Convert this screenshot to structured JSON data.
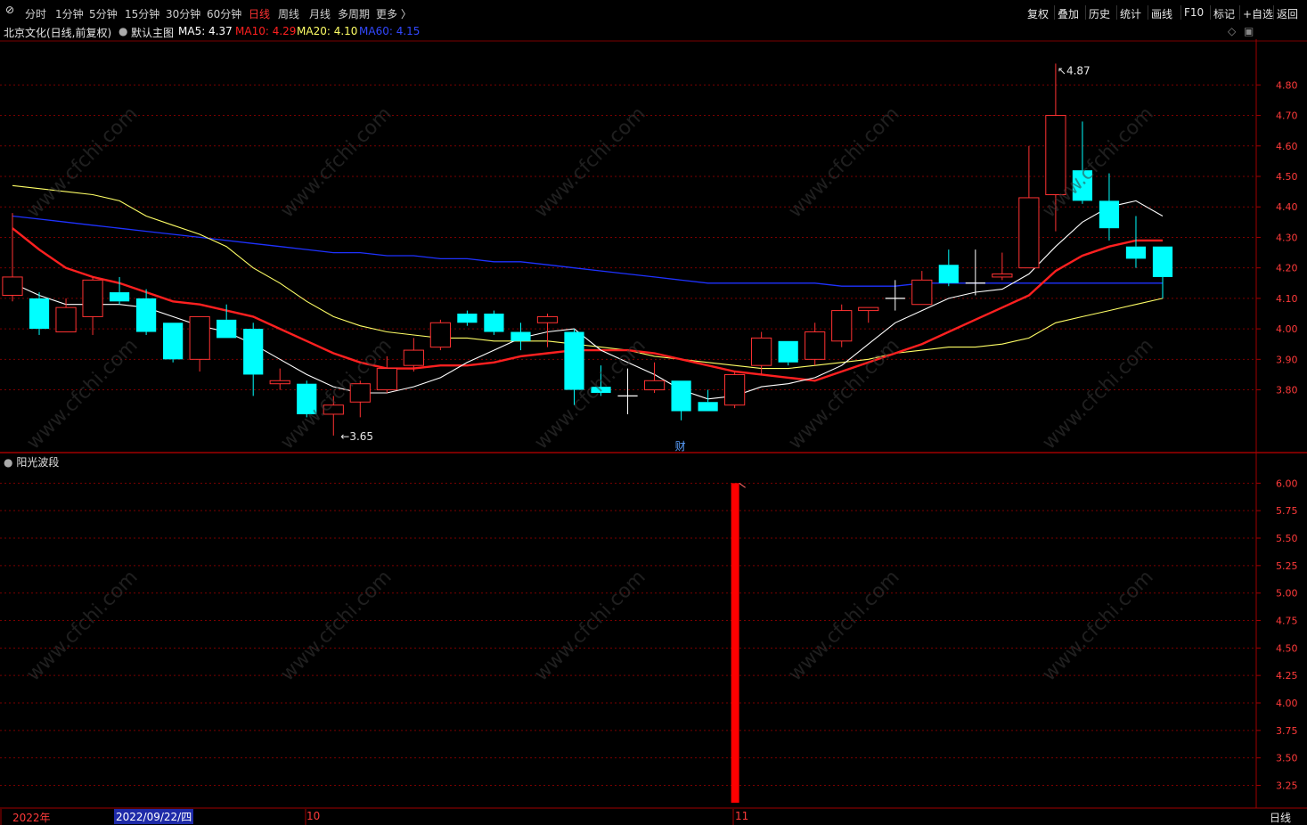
{
  "toolbar": {
    "periods": [
      {
        "label": "分时",
        "active": false
      },
      {
        "label": "1分钟",
        "active": false
      },
      {
        "label": "5分钟",
        "active": false
      },
      {
        "label": "15分钟",
        "active": false
      },
      {
        "label": "30分钟",
        "active": false
      },
      {
        "label": "60分钟",
        "active": false
      },
      {
        "label": "日线",
        "active": true
      },
      {
        "label": "周线",
        "active": false
      },
      {
        "label": "月线",
        "active": false
      },
      {
        "label": "多周期",
        "active": false
      },
      {
        "label": "更多 〉",
        "active": false
      }
    ],
    "tools": [
      "复权",
      "叠加",
      "历史",
      "统计",
      "画线",
      "F10",
      "标记",
      "+自选",
      "返回"
    ]
  },
  "legend": {
    "stock": "北京文化(日线,前复权)",
    "template": "默认主图",
    "ma5": "MA5: 4.37",
    "ma10": "MA10: 4.29",
    "ma20": "MA20: 4.10",
    "ma60": "MA60: 4.15"
  },
  "colors": {
    "up": "#ff3232",
    "down": "#00ffff",
    "ma5": "#ffffff",
    "ma10": "#ff2020",
    "ma20": "#ffff66",
    "ma60": "#1e32ff",
    "grid": "#7a0000",
    "axis_text": "#ff3a3a"
  },
  "main_axis": {
    "ticks": [
      "4.80",
      "4.70",
      "4.60",
      "4.50",
      "4.40",
      "4.30",
      "4.20",
      "4.10",
      "4.00",
      "3.90",
      "3.80"
    ]
  },
  "sub_axis": {
    "ticks": [
      "6.00",
      "5.75",
      "5.50",
      "5.25",
      "5.00",
      "4.75",
      "4.50",
      "4.25",
      "4.00",
      "3.75",
      "3.50",
      "3.25"
    ]
  },
  "annotations": {
    "high": "4.87",
    "low": "3.65",
    "cai": "财"
  },
  "indicator": {
    "name": "阳光波段",
    "bar_value": 6.0
  },
  "status": {
    "year": "2022年",
    "date": "2022/09/22/四",
    "oct": "10",
    "nov": "11",
    "period": "日线"
  },
  "watermark": "www.cfchi.com",
  "chart_data": {
    "type": "candlestick",
    "title": "北京文化(日线,前复权)",
    "ylim": [
      3.6,
      4.95
    ],
    "candles": [
      {
        "o": 4.11,
        "c": 4.17,
        "h": 4.38,
        "l": 4.09
      },
      {
        "o": 4.1,
        "c": 4.0,
        "h": 4.12,
        "l": 3.98
      },
      {
        "o": 3.99,
        "c": 4.07,
        "h": 4.1,
        "l": 3.99
      },
      {
        "o": 4.04,
        "c": 4.16,
        "h": 4.17,
        "l": 3.98
      },
      {
        "o": 4.12,
        "c": 4.09,
        "h": 4.17,
        "l": 4.08
      },
      {
        "o": 4.1,
        "c": 3.99,
        "h": 4.13,
        "l": 3.98
      },
      {
        "o": 4.02,
        "c": 3.9,
        "h": 4.02,
        "l": 3.89
      },
      {
        "o": 3.9,
        "c": 4.04,
        "h": 4.04,
        "l": 3.86
      },
      {
        "o": 4.03,
        "c": 3.97,
        "h": 4.08,
        "l": 3.97
      },
      {
        "o": 4.0,
        "c": 3.85,
        "h": 4.02,
        "l": 3.78
      },
      {
        "o": 3.82,
        "c": 3.83,
        "h": 3.87,
        "l": 3.8
      },
      {
        "o": 3.82,
        "c": 3.72,
        "h": 3.83,
        "l": 3.71
      },
      {
        "o": 3.72,
        "c": 3.75,
        "h": 3.78,
        "l": 3.65
      },
      {
        "o": 3.76,
        "c": 3.82,
        "h": 3.83,
        "l": 3.71
      },
      {
        "o": 3.8,
        "c": 3.87,
        "h": 3.91,
        "l": 3.79
      },
      {
        "o": 3.88,
        "c": 3.93,
        "h": 3.97,
        "l": 3.86
      },
      {
        "o": 3.94,
        "c": 4.02,
        "h": 4.03,
        "l": 3.93
      },
      {
        "o": 4.05,
        "c": 4.02,
        "h": 4.06,
        "l": 4.01
      },
      {
        "o": 4.05,
        "c": 3.99,
        "h": 4.06,
        "l": 3.98
      },
      {
        "o": 3.99,
        "c": 3.96,
        "h": 4.02,
        "l": 3.93
      },
      {
        "o": 4.02,
        "c": 4.04,
        "h": 4.05,
        "l": 3.94
      },
      {
        "o": 3.99,
        "c": 3.8,
        "h": 4.0,
        "l": 3.75
      },
      {
        "o": 3.81,
        "c": 3.79,
        "h": 3.88,
        "l": 3.78
      },
      {
        "o": 3.78,
        "c": 3.78,
        "h": 3.87,
        "l": 3.72
      },
      {
        "o": 3.8,
        "c": 3.83,
        "h": 3.89,
        "l": 3.79
      },
      {
        "o": 3.83,
        "c": 3.73,
        "h": 3.83,
        "l": 3.7
      },
      {
        "o": 3.76,
        "c": 3.73,
        "h": 3.8,
        "l": 3.73
      },
      {
        "o": 3.75,
        "c": 3.85,
        "h": 3.86,
        "l": 3.74
      },
      {
        "o": 3.88,
        "c": 3.97,
        "h": 3.99,
        "l": 3.85
      },
      {
        "o": 3.96,
        "c": 3.89,
        "h": 3.96,
        "l": 3.88
      },
      {
        "o": 3.9,
        "c": 3.99,
        "h": 4.02,
        "l": 3.88
      },
      {
        "o": 3.96,
        "c": 4.06,
        "h": 4.08,
        "l": 3.94
      },
      {
        "o": 4.06,
        "c": 4.07,
        "h": 4.07,
        "l": 4.02
      },
      {
        "o": 4.1,
        "c": 4.1,
        "h": 4.16,
        "l": 4.06
      },
      {
        "o": 4.08,
        "c": 4.16,
        "h": 4.19,
        "l": 4.08
      },
      {
        "o": 4.21,
        "c": 4.15,
        "h": 4.26,
        "l": 4.14
      },
      {
        "o": 4.15,
        "c": 4.15,
        "h": 4.26,
        "l": 4.11
      },
      {
        "o": 4.17,
        "c": 4.18,
        "h": 4.25,
        "l": 4.16
      },
      {
        "o": 4.2,
        "c": 4.43,
        "h": 4.6,
        "l": 4.2
      },
      {
        "o": 4.44,
        "c": 4.7,
        "h": 4.87,
        "l": 4.32
      },
      {
        "o": 4.52,
        "c": 4.42,
        "h": 4.68,
        "l": 4.41
      },
      {
        "o": 4.42,
        "c": 4.33,
        "h": 4.51,
        "l": 4.29
      },
      {
        "o": 4.27,
        "c": 4.23,
        "h": 4.37,
        "l": 4.2
      },
      {
        "o": 4.27,
        "c": 4.17,
        "h": 4.27,
        "l": 4.1
      }
    ],
    "ma5": [
      4.15,
      4.11,
      4.08,
      4.08,
      4.08,
      4.07,
      4.04,
      4.01,
      3.99,
      3.95,
      3.9,
      3.85,
      3.81,
      3.79,
      3.79,
      3.81,
      3.84,
      3.89,
      3.93,
      3.97,
      3.99,
      4.0,
      3.93,
      3.89,
      3.85,
      3.8,
      3.77,
      3.78,
      3.81,
      3.82,
      3.84,
      3.88,
      3.95,
      4.02,
      4.06,
      4.1,
      4.12,
      4.13,
      4.18,
      4.27,
      4.35,
      4.4,
      4.42,
      4.37
    ],
    "ma10": [
      4.33,
      4.26,
      4.2,
      4.17,
      4.15,
      4.12,
      4.09,
      4.08,
      4.06,
      4.04,
      4.0,
      3.96,
      3.92,
      3.89,
      3.87,
      3.87,
      3.88,
      3.88,
      3.89,
      3.91,
      3.92,
      3.93,
      3.93,
      3.93,
      3.92,
      3.9,
      3.88,
      3.86,
      3.85,
      3.84,
      3.83,
      3.86,
      3.89,
      3.92,
      3.95,
      3.99,
      4.03,
      4.07,
      4.11,
      4.19,
      4.24,
      4.27,
      4.29,
      4.29
    ],
    "ma20": [
      4.47,
      4.46,
      4.45,
      4.44,
      4.42,
      4.37,
      4.34,
      4.31,
      4.27,
      4.2,
      4.15,
      4.09,
      4.04,
      4.01,
      3.99,
      3.98,
      3.97,
      3.97,
      3.96,
      3.96,
      3.96,
      3.95,
      3.94,
      3.93,
      3.91,
      3.9,
      3.89,
      3.88,
      3.87,
      3.87,
      3.88,
      3.89,
      3.9,
      3.92,
      3.93,
      3.94,
      3.94,
      3.95,
      3.97,
      4.02,
      4.04,
      4.06,
      4.08,
      4.1
    ],
    "ma60": [
      4.37,
      4.36,
      4.35,
      4.34,
      4.33,
      4.32,
      4.31,
      4.3,
      4.29,
      4.28,
      4.27,
      4.26,
      4.25,
      4.25,
      4.24,
      4.24,
      4.23,
      4.23,
      4.22,
      4.22,
      4.21,
      4.2,
      4.19,
      4.18,
      4.17,
      4.16,
      4.15,
      4.15,
      4.15,
      4.15,
      4.15,
      4.14,
      4.14,
      4.14,
      4.15,
      4.15,
      4.15,
      4.15,
      4.15,
      4.15,
      4.15,
      4.15,
      4.15,
      4.15
    ],
    "indicator": {
      "name": "阳光波段",
      "type": "bar",
      "index": 27,
      "value": 6.0,
      "ylim": [
        3.1,
        6.1
      ]
    }
  }
}
